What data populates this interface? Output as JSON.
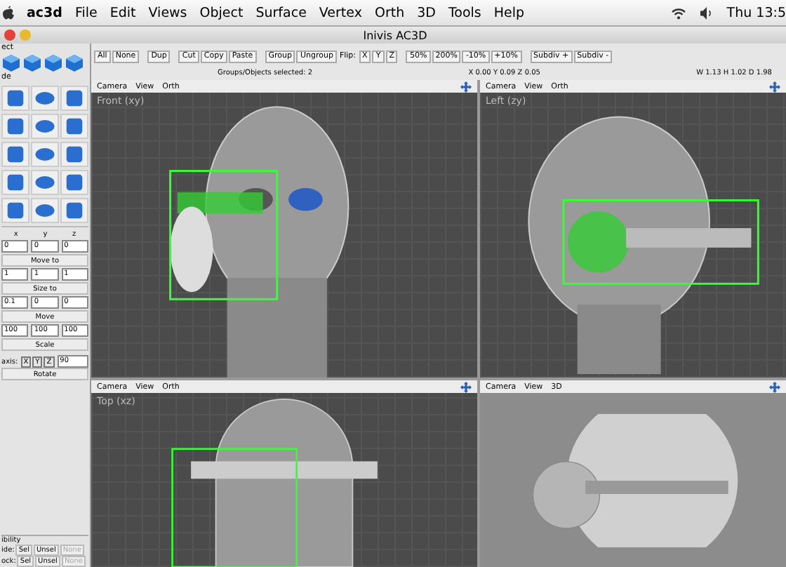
{
  "menubar": {
    "app": "ac3d",
    "items": [
      "File",
      "Edit",
      "Views",
      "Object",
      "Surface",
      "Vertex",
      "Orth",
      "3D",
      "Tools",
      "Help"
    ],
    "clock": "Thu 13:5"
  },
  "window": {
    "title": "Inivis AC3D"
  },
  "toolbar": [
    {
      "kind": "button",
      "label": "All"
    },
    {
      "kind": "button",
      "label": "None"
    },
    {
      "kind": "gap"
    },
    {
      "kind": "button",
      "label": "Dup"
    },
    {
      "kind": "gap"
    },
    {
      "kind": "button",
      "label": "Cut"
    },
    {
      "kind": "button",
      "label": "Copy"
    },
    {
      "kind": "button",
      "label": "Paste"
    },
    {
      "kind": "gap"
    },
    {
      "kind": "button",
      "label": "Group"
    },
    {
      "kind": "button",
      "label": "Ungroup"
    },
    {
      "kind": "label",
      "label": "Flip:"
    },
    {
      "kind": "button",
      "label": "X"
    },
    {
      "kind": "button",
      "label": "Y"
    },
    {
      "kind": "button",
      "label": "Z"
    },
    {
      "kind": "gap"
    },
    {
      "kind": "button",
      "label": "50%"
    },
    {
      "kind": "button",
      "label": "200%"
    },
    {
      "kind": "button",
      "label": "-10%"
    },
    {
      "kind": "button",
      "label": "+10%"
    },
    {
      "kind": "gap"
    },
    {
      "kind": "button",
      "label": "Subdiv +"
    },
    {
      "kind": "button",
      "label": "Subdiv -"
    }
  ],
  "status": {
    "selected": "Groups/Objects selected: 2",
    "position": "X 0.00 Y 0.09 Z 0.05",
    "size": "W 1.13 H 1.02 D 1.98"
  },
  "panel": {
    "header_1": "ect",
    "header_2": "de",
    "axis_labels": [
      "x",
      "y",
      "z"
    ],
    "groups": [
      {
        "values": [
          "0",
          "0",
          "0"
        ],
        "button": "Move to"
      },
      {
        "values": [
          "1",
          "1",
          "1"
        ],
        "button": "Size to"
      },
      {
        "values": [
          "0.1",
          "0",
          "0"
        ],
        "button": "Move"
      },
      {
        "values": [
          "100",
          "100",
          "100"
        ],
        "button": "Scale"
      }
    ],
    "rotate": {
      "label": "axis:",
      "axes": [
        "X",
        "Y",
        "Z"
      ],
      "angle": "90",
      "button": "Rotate"
    },
    "visibility": {
      "title": "ibility",
      "rows": [
        {
          "label": "ide:",
          "buttons": [
            {
              "label": "Sel",
              "disabled": false
            },
            {
              "label": "Unsel",
              "disabled": false
            },
            {
              "label": "None",
              "disabled": true
            }
          ]
        },
        {
          "label": "ock:",
          "buttons": [
            {
              "label": "Sel",
              "disabled": false
            },
            {
              "label": "Unsel",
              "disabled": false
            },
            {
              "label": "None",
              "disabled": true
            }
          ]
        }
      ]
    }
  },
  "viewports": [
    {
      "kind": "front",
      "menu": [
        "Camera",
        "View",
        "Orth"
      ],
      "label": "Front (xy)"
    },
    {
      "kind": "side",
      "menu": [
        "Camera",
        "View",
        "Orth"
      ],
      "label": "Left (zy)"
    },
    {
      "kind": "top",
      "menu": [
        "Camera",
        "View",
        "Orth"
      ],
      "label": "Top (xz)"
    },
    {
      "kind": "render",
      "menu": [
        "Camera",
        "View",
        "3D"
      ]
    }
  ]
}
